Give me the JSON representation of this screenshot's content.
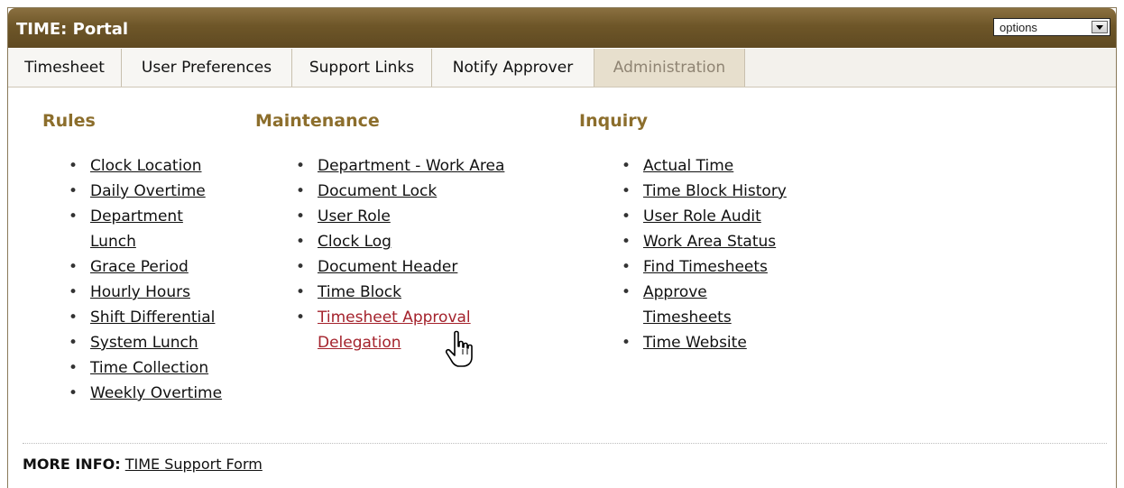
{
  "header": {
    "title": "TIME: Portal",
    "options": {
      "selected": "options"
    }
  },
  "tabs": [
    {
      "label": "Timesheet"
    },
    {
      "label": "User Preferences"
    },
    {
      "label": "Support Links"
    },
    {
      "label": "Notify Approver"
    },
    {
      "label": "Administration",
      "active": true
    }
  ],
  "sections": {
    "rules": {
      "heading": "Rules",
      "items": [
        "Clock Location",
        "Daily Overtime",
        "Department Lunch",
        "Grace Period",
        "Hourly Hours",
        "Shift Differential",
        "System Lunch",
        "Time Collection",
        "Weekly Overtime"
      ]
    },
    "maintenance": {
      "heading": "Maintenance",
      "items": [
        "Department - Work Area",
        "Document Lock",
        "User Role",
        "Clock Log",
        "Document Header",
        "Time Block",
        "Timesheet Approval Delegation"
      ]
    },
    "inquiry": {
      "heading": "Inquiry",
      "items": [
        "Actual Time",
        "Time Block History",
        "User Role Audit",
        "Work Area Status",
        "Find Timesheets",
        "Approve Timesheets",
        "Time Website"
      ]
    }
  },
  "footer": {
    "label": "MORE INFO:",
    "link": "TIME Support Form"
  },
  "colors": {
    "header_brown": "#6e5628",
    "section_heading": "#8c6e2c",
    "hover_link": "#a4222c",
    "active_tab": "#e7dfcd"
  }
}
